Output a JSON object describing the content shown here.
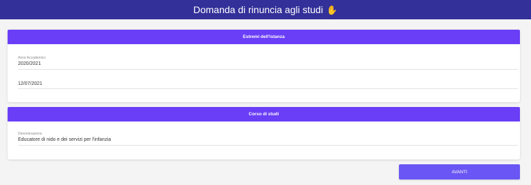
{
  "header": {
    "title": "Domanda di rinuncia agli studi",
    "icon": "hand-icon"
  },
  "section_istanza": {
    "title": "Estremi dell'istanza",
    "fields": [
      {
        "label": "Anno Accademico",
        "value": "2020/2021"
      },
      {
        "label": "",
        "value": "12/07/2021"
      }
    ]
  },
  "section_corso": {
    "title": "Corso di studi",
    "fields": [
      {
        "label": "Denominazione",
        "value": "Educatore di nido e dei servizi per l'infanzia"
      }
    ]
  },
  "actions": {
    "next_label": "AVANTI"
  },
  "colors": {
    "topbar": "#33309a",
    "section_header": "#6a3ef7",
    "button": "#6a56f4"
  }
}
